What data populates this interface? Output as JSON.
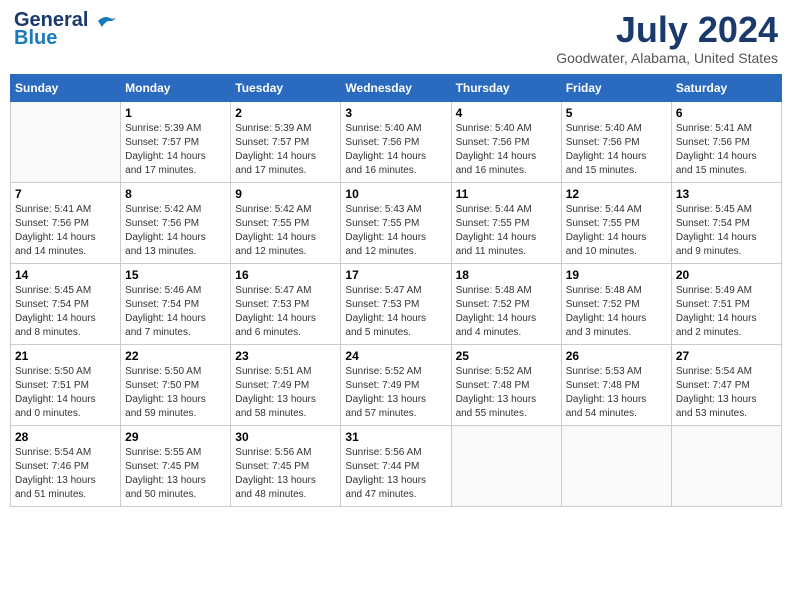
{
  "header": {
    "logo_line1": "General",
    "logo_line2": "Blue",
    "month": "July 2024",
    "location": "Goodwater, Alabama, United States"
  },
  "weekdays": [
    "Sunday",
    "Monday",
    "Tuesday",
    "Wednesday",
    "Thursday",
    "Friday",
    "Saturday"
  ],
  "weeks": [
    [
      {
        "day": "",
        "info": ""
      },
      {
        "day": "1",
        "info": "Sunrise: 5:39 AM\nSunset: 7:57 PM\nDaylight: 14 hours\nand 17 minutes."
      },
      {
        "day": "2",
        "info": "Sunrise: 5:39 AM\nSunset: 7:57 PM\nDaylight: 14 hours\nand 17 minutes."
      },
      {
        "day": "3",
        "info": "Sunrise: 5:40 AM\nSunset: 7:56 PM\nDaylight: 14 hours\nand 16 minutes."
      },
      {
        "day": "4",
        "info": "Sunrise: 5:40 AM\nSunset: 7:56 PM\nDaylight: 14 hours\nand 16 minutes."
      },
      {
        "day": "5",
        "info": "Sunrise: 5:40 AM\nSunset: 7:56 PM\nDaylight: 14 hours\nand 15 minutes."
      },
      {
        "day": "6",
        "info": "Sunrise: 5:41 AM\nSunset: 7:56 PM\nDaylight: 14 hours\nand 15 minutes."
      }
    ],
    [
      {
        "day": "7",
        "info": "Sunrise: 5:41 AM\nSunset: 7:56 PM\nDaylight: 14 hours\nand 14 minutes."
      },
      {
        "day": "8",
        "info": "Sunrise: 5:42 AM\nSunset: 7:56 PM\nDaylight: 14 hours\nand 13 minutes."
      },
      {
        "day": "9",
        "info": "Sunrise: 5:42 AM\nSunset: 7:55 PM\nDaylight: 14 hours\nand 12 minutes."
      },
      {
        "day": "10",
        "info": "Sunrise: 5:43 AM\nSunset: 7:55 PM\nDaylight: 14 hours\nand 12 minutes."
      },
      {
        "day": "11",
        "info": "Sunrise: 5:44 AM\nSunset: 7:55 PM\nDaylight: 14 hours\nand 11 minutes."
      },
      {
        "day": "12",
        "info": "Sunrise: 5:44 AM\nSunset: 7:55 PM\nDaylight: 14 hours\nand 10 minutes."
      },
      {
        "day": "13",
        "info": "Sunrise: 5:45 AM\nSunset: 7:54 PM\nDaylight: 14 hours\nand 9 minutes."
      }
    ],
    [
      {
        "day": "14",
        "info": "Sunrise: 5:45 AM\nSunset: 7:54 PM\nDaylight: 14 hours\nand 8 minutes."
      },
      {
        "day": "15",
        "info": "Sunrise: 5:46 AM\nSunset: 7:54 PM\nDaylight: 14 hours\nand 7 minutes."
      },
      {
        "day": "16",
        "info": "Sunrise: 5:47 AM\nSunset: 7:53 PM\nDaylight: 14 hours\nand 6 minutes."
      },
      {
        "day": "17",
        "info": "Sunrise: 5:47 AM\nSunset: 7:53 PM\nDaylight: 14 hours\nand 5 minutes."
      },
      {
        "day": "18",
        "info": "Sunrise: 5:48 AM\nSunset: 7:52 PM\nDaylight: 14 hours\nand 4 minutes."
      },
      {
        "day": "19",
        "info": "Sunrise: 5:48 AM\nSunset: 7:52 PM\nDaylight: 14 hours\nand 3 minutes."
      },
      {
        "day": "20",
        "info": "Sunrise: 5:49 AM\nSunset: 7:51 PM\nDaylight: 14 hours\nand 2 minutes."
      }
    ],
    [
      {
        "day": "21",
        "info": "Sunrise: 5:50 AM\nSunset: 7:51 PM\nDaylight: 14 hours\nand 0 minutes."
      },
      {
        "day": "22",
        "info": "Sunrise: 5:50 AM\nSunset: 7:50 PM\nDaylight: 13 hours\nand 59 minutes."
      },
      {
        "day": "23",
        "info": "Sunrise: 5:51 AM\nSunset: 7:49 PM\nDaylight: 13 hours\nand 58 minutes."
      },
      {
        "day": "24",
        "info": "Sunrise: 5:52 AM\nSunset: 7:49 PM\nDaylight: 13 hours\nand 57 minutes."
      },
      {
        "day": "25",
        "info": "Sunrise: 5:52 AM\nSunset: 7:48 PM\nDaylight: 13 hours\nand 55 minutes."
      },
      {
        "day": "26",
        "info": "Sunrise: 5:53 AM\nSunset: 7:48 PM\nDaylight: 13 hours\nand 54 minutes."
      },
      {
        "day": "27",
        "info": "Sunrise: 5:54 AM\nSunset: 7:47 PM\nDaylight: 13 hours\nand 53 minutes."
      }
    ],
    [
      {
        "day": "28",
        "info": "Sunrise: 5:54 AM\nSunset: 7:46 PM\nDaylight: 13 hours\nand 51 minutes."
      },
      {
        "day": "29",
        "info": "Sunrise: 5:55 AM\nSunset: 7:45 PM\nDaylight: 13 hours\nand 50 minutes."
      },
      {
        "day": "30",
        "info": "Sunrise: 5:56 AM\nSunset: 7:45 PM\nDaylight: 13 hours\nand 48 minutes."
      },
      {
        "day": "31",
        "info": "Sunrise: 5:56 AM\nSunset: 7:44 PM\nDaylight: 13 hours\nand 47 minutes."
      },
      {
        "day": "",
        "info": ""
      },
      {
        "day": "",
        "info": ""
      },
      {
        "day": "",
        "info": ""
      }
    ]
  ]
}
